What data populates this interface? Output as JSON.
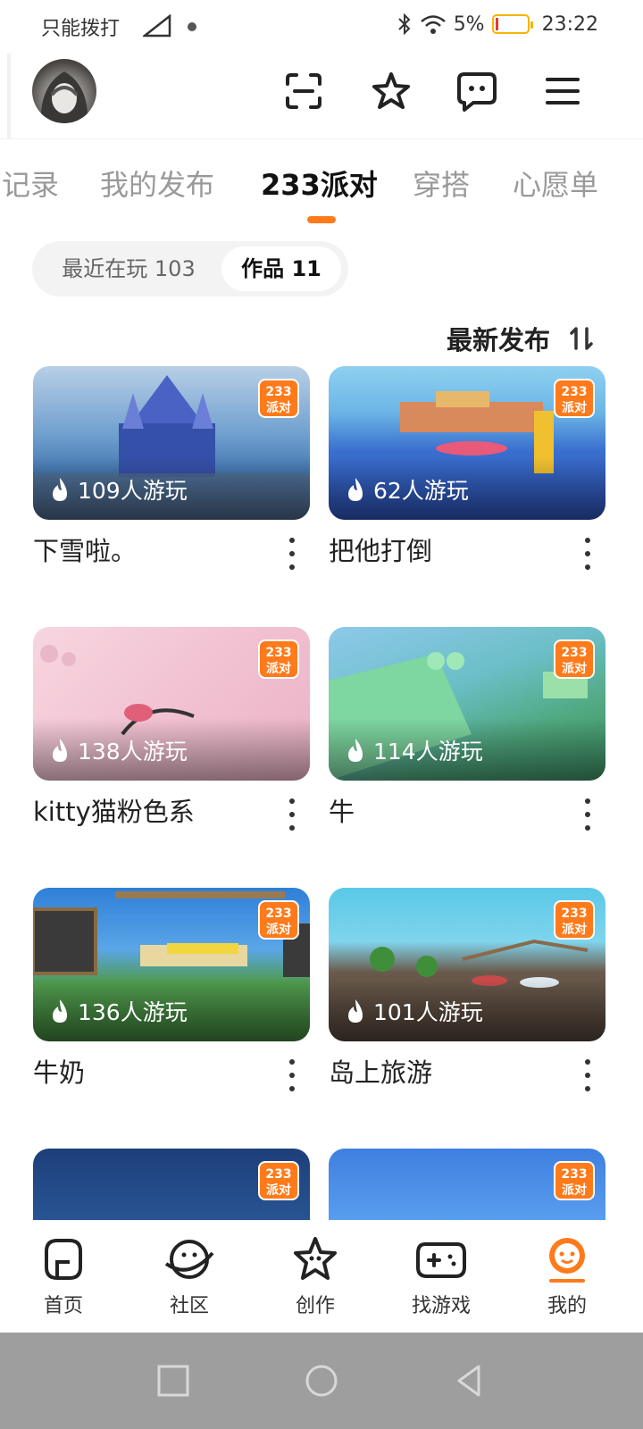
{
  "status_bar": {
    "carrier_text": "只能拨打",
    "battery": "5%",
    "time": "23:22"
  },
  "header": {
    "icons": [
      "scan-icon",
      "star-icon",
      "message-icon",
      "menu-icon"
    ]
  },
  "tabs": [
    {
      "label": "记录",
      "active": false
    },
    {
      "label": "我的发布",
      "active": false
    },
    {
      "label": "233派对",
      "active": true
    },
    {
      "label": "穿搭",
      "active": false
    },
    {
      "label": "心愿单",
      "active": false
    }
  ],
  "segment": {
    "recent": "最近在玩 103",
    "works": "作品 11"
  },
  "sort": {
    "label": "最新发布",
    "icon": "sort-icon"
  },
  "badge_text": {
    "line1": "233",
    "line2": "派对"
  },
  "games": [
    {
      "title": "下雪啦。",
      "plays": "109人游玩"
    },
    {
      "title": "把他打倒",
      "plays": "62人游玩"
    },
    {
      "title": "kitty猫粉色系",
      "plays": "138人游玩"
    },
    {
      "title": "牛",
      "plays": "114人游玩"
    },
    {
      "title": "牛奶",
      "plays": "136人游玩"
    },
    {
      "title": "岛上旅游",
      "plays": "101人游玩"
    }
  ],
  "bottom_nav": [
    {
      "label": "首页",
      "icon": "home-icon",
      "active": false
    },
    {
      "label": "社区",
      "icon": "planet-icon",
      "active": false
    },
    {
      "label": "创作",
      "icon": "create-star-icon",
      "active": false
    },
    {
      "label": "找游戏",
      "icon": "gamepad-icon",
      "active": false
    },
    {
      "label": "我的",
      "icon": "profile-icon",
      "active": true
    }
  ],
  "colors": {
    "accent": "#ff7a1a",
    "text": "#222222",
    "muted": "#999999"
  }
}
